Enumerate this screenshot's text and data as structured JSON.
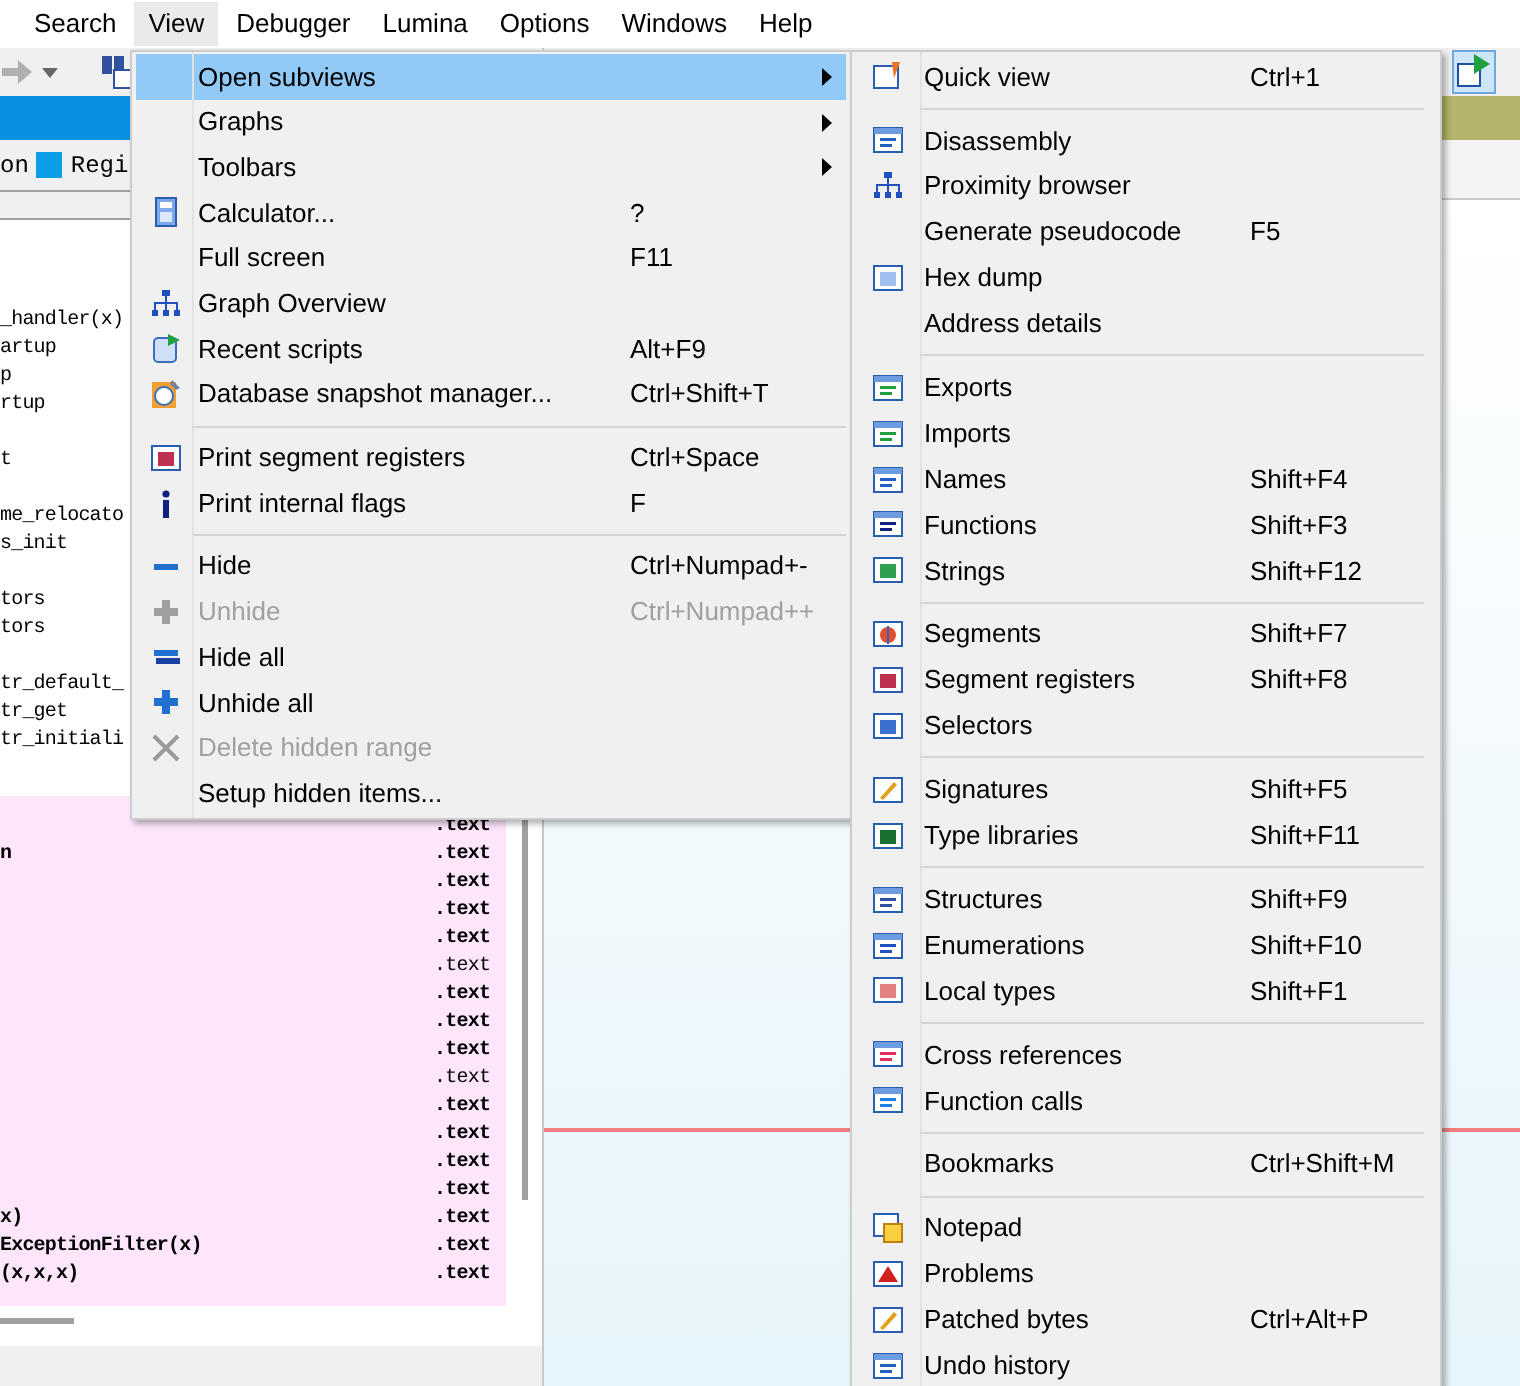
{
  "menu_bar": [
    {
      "label": "Search",
      "selected": false
    },
    {
      "label": "View",
      "selected": true
    },
    {
      "label": "Debugger",
      "selected": false
    },
    {
      "label": "Lumina",
      "selected": false
    },
    {
      "label": "Options",
      "selected": false
    },
    {
      "label": "Windows",
      "selected": false
    },
    {
      "label": "Help",
      "selected": false
    }
  ],
  "legend": [
    {
      "label": "on"
    },
    {
      "label": "Regi",
      "color": "#0a9fe6"
    }
  ],
  "function_groups": [
    [
      "_handler(x)",
      "artup",
      "p",
      "rtup"
    ],
    [
      "t"
    ],
    [
      "me_relocato",
      "s_init"
    ],
    [
      "tors",
      "tors"
    ],
    [
      "tr_default_",
      "tr_get",
      "tr_initiali"
    ]
  ],
  "segment_list": [
    {
      "segment": ".text",
      "bold": true
    },
    {
      "name": "n",
      "segment": ".text",
      "bold": true
    },
    {
      "segment": ".text",
      "bold": true
    },
    {
      "segment": ".text",
      "bold": true
    },
    {
      "segment": ".text",
      "bold": true
    },
    {
      "segment": ".text",
      "bold": false
    },
    {
      "segment": ".text",
      "bold": true
    },
    {
      "segment": ".text",
      "bold": true
    },
    {
      "segment": ".text",
      "bold": true
    },
    {
      "segment": ".text",
      "bold": false
    },
    {
      "segment": ".text",
      "bold": true
    },
    {
      "segment": ".text",
      "bold": true
    },
    {
      "segment": ".text",
      "bold": true
    },
    {
      "segment": ".text",
      "bold": true
    },
    {
      "name": "x)",
      "segment": ".text",
      "bold": true
    },
    {
      "name": "ExceptionFilter(x)",
      "segment": ".text",
      "bold": true
    },
    {
      "name": "(x,x,x)",
      "segment": ".text",
      "bold": true
    }
  ],
  "view_menu": [
    {
      "kind": "item",
      "label": "Open subviews",
      "submenu": true,
      "selected": true,
      "disabled": false
    },
    {
      "kind": "item",
      "label": "Graphs",
      "submenu": true,
      "selected": false,
      "disabled": false
    },
    {
      "kind": "item",
      "label": "Toolbars",
      "submenu": true,
      "selected": false,
      "disabled": false
    },
    {
      "kind": "item",
      "label": "Calculator...",
      "shortcut": "?",
      "selected": false,
      "disabled": false
    },
    {
      "kind": "item",
      "label": "Full screen",
      "shortcut": "F11",
      "selected": false,
      "disabled": false
    },
    {
      "kind": "item",
      "label": "Graph Overview",
      "selected": false,
      "disabled": false
    },
    {
      "kind": "item",
      "label": "Recent scripts",
      "shortcut": "Alt+F9",
      "selected": false,
      "disabled": false
    },
    {
      "kind": "item",
      "label": "Database snapshot manager...",
      "shortcut": "Ctrl+Shift+T",
      "selected": false,
      "disabled": false
    },
    {
      "kind": "separator"
    },
    {
      "kind": "item",
      "label": "Print segment registers",
      "shortcut": "Ctrl+Space",
      "selected": false,
      "disabled": false
    },
    {
      "kind": "item",
      "label": "Print internal flags",
      "shortcut": "F",
      "selected": false,
      "disabled": false
    },
    {
      "kind": "separator"
    },
    {
      "kind": "item",
      "label": "Hide",
      "shortcut": "Ctrl+Numpad+-",
      "selected": false,
      "disabled": false
    },
    {
      "kind": "item",
      "label": "Unhide",
      "shortcut": "Ctrl+Numpad++",
      "selected": false,
      "disabled": true
    },
    {
      "kind": "item",
      "label": "Hide all",
      "selected": false,
      "disabled": false
    },
    {
      "kind": "item",
      "label": "Unhide all",
      "selected": false,
      "disabled": false
    },
    {
      "kind": "item",
      "label": "Delete hidden range",
      "selected": false,
      "disabled": true
    },
    {
      "kind": "item",
      "label": "Setup hidden items...",
      "selected": false,
      "disabled": false
    }
  ],
  "subviews_menu": [
    {
      "kind": "item",
      "label": "Quick view",
      "shortcut": "Ctrl+1"
    },
    {
      "kind": "separator"
    },
    {
      "kind": "item",
      "label": "Disassembly"
    },
    {
      "kind": "item",
      "label": "Proximity browser"
    },
    {
      "kind": "item",
      "label": "Generate pseudocode",
      "shortcut": "F5"
    },
    {
      "kind": "item",
      "label": "Hex dump"
    },
    {
      "kind": "item",
      "label": "Address details"
    },
    {
      "kind": "separator"
    },
    {
      "kind": "item",
      "label": "Exports"
    },
    {
      "kind": "item",
      "label": "Imports"
    },
    {
      "kind": "item",
      "label": "Names",
      "shortcut": "Shift+F4"
    },
    {
      "kind": "item",
      "label": "Functions",
      "shortcut": "Shift+F3"
    },
    {
      "kind": "item",
      "label": "Strings",
      "shortcut": "Shift+F12"
    },
    {
      "kind": "separator"
    },
    {
      "kind": "item",
      "label": "Segments",
      "shortcut": "Shift+F7"
    },
    {
      "kind": "item",
      "label": "Segment registers",
      "shortcut": "Shift+F8"
    },
    {
      "kind": "item",
      "label": "Selectors"
    },
    {
      "kind": "separator"
    },
    {
      "kind": "item",
      "label": "Signatures",
      "shortcut": "Shift+F5"
    },
    {
      "kind": "item",
      "label": "Type libraries",
      "shortcut": "Shift+F11"
    },
    {
      "kind": "separator"
    },
    {
      "kind": "item",
      "label": "Structures",
      "shortcut": "Shift+F9"
    },
    {
      "kind": "item",
      "label": "Enumerations",
      "shortcut": "Shift+F10"
    },
    {
      "kind": "item",
      "label": "Local types",
      "shortcut": "Shift+F1"
    },
    {
      "kind": "separator"
    },
    {
      "kind": "item",
      "label": "Cross references"
    },
    {
      "kind": "item",
      "label": "Function calls"
    },
    {
      "kind": "separator"
    },
    {
      "kind": "item",
      "label": "Bookmarks",
      "shortcut": "Ctrl+Shift+M"
    },
    {
      "kind": "separator"
    },
    {
      "kind": "item",
      "label": "Notepad"
    },
    {
      "kind": "item",
      "label": "Problems"
    },
    {
      "kind": "item",
      "label": "Patched bytes",
      "shortcut": "Ctrl+Alt+P"
    },
    {
      "kind": "item",
      "label": "Undo history"
    }
  ]
}
